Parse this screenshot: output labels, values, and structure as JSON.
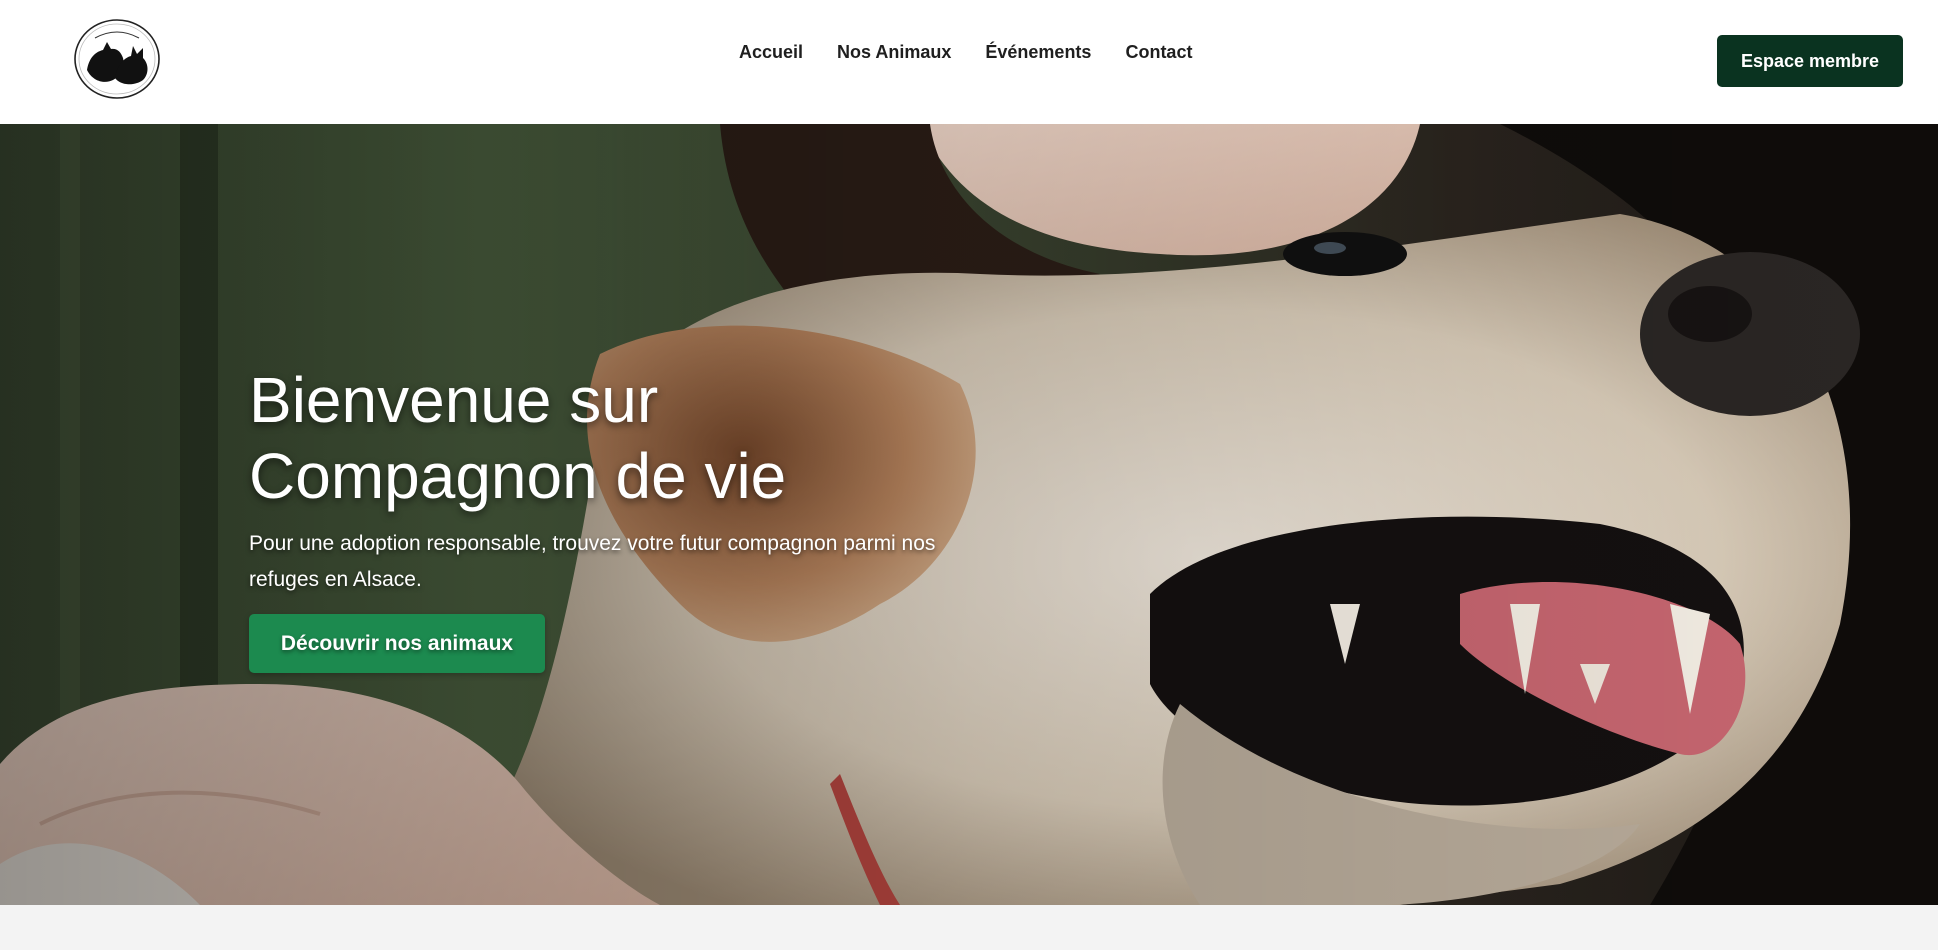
{
  "header": {
    "logo_icon": "cat-dog-silhouette-logo",
    "nav": [
      {
        "label": "Accueil"
      },
      {
        "label": "Nos Animaux"
      },
      {
        "label": "Événements"
      },
      {
        "label": "Contact"
      }
    ],
    "member_button_label": "Espace membre"
  },
  "hero": {
    "background_image": "woman-hugging-smiling-dog-photo",
    "title_line1": "Bienvenue sur",
    "title_line2": "Compagnon de vie",
    "subtitle": "Pour une adoption responsable, trouvez votre futur compagnon parmi nos refuges en Alsace.",
    "cta_label": "Découvrir nos animaux"
  },
  "colors": {
    "header_bg": "#ffffff",
    "member_button_bg": "#0a3320",
    "cta_bg": "#1c8a4f",
    "page_bg": "#f3f3f3"
  }
}
